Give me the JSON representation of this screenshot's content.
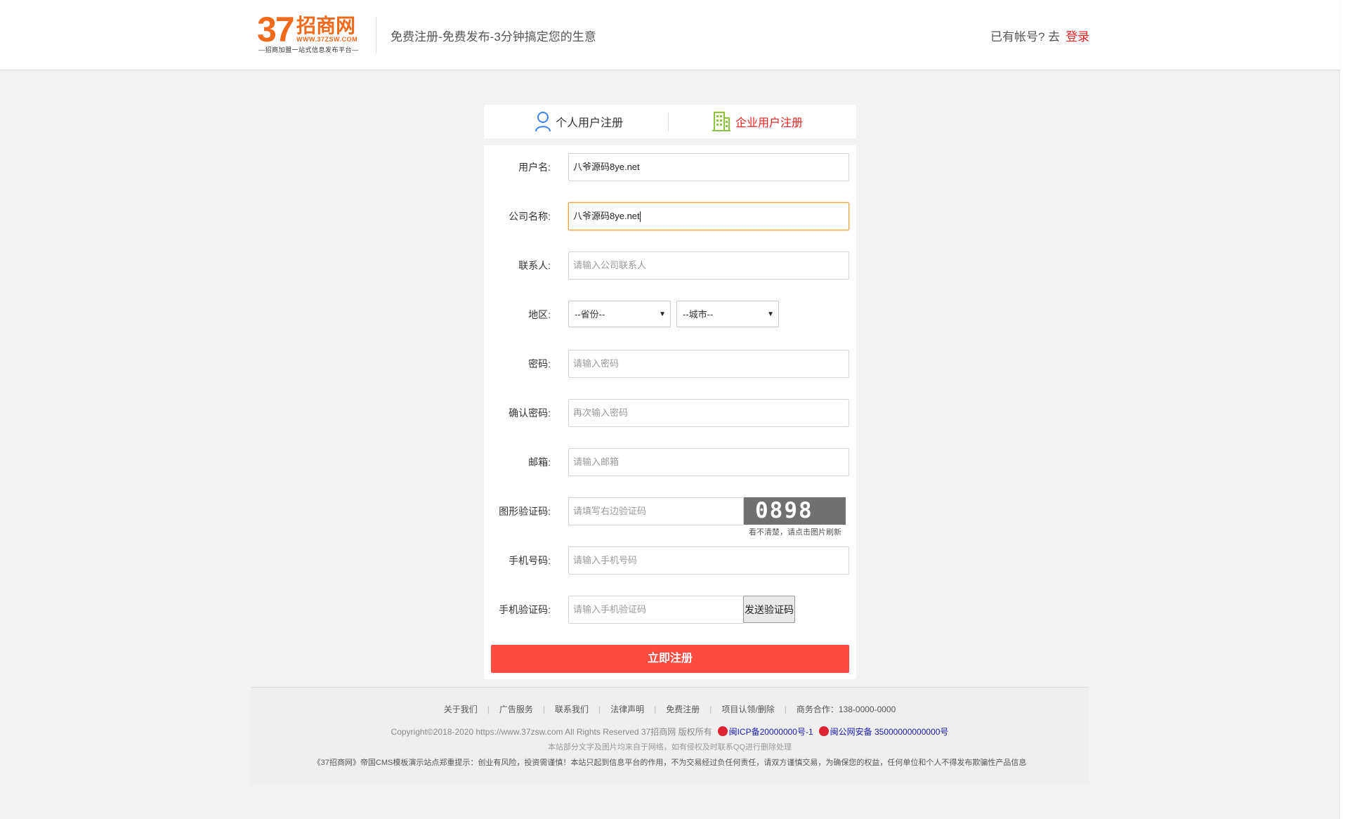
{
  "header": {
    "logo_number": "37",
    "logo_name": "招商网",
    "logo_url": "WWW.37ZSW.COM",
    "logo_slogan": "—招商加盟一站式信息发布平台—",
    "tagline": "免费注册-免费发布-3分钟搞定您的生意",
    "login_prompt": "已有帐号? 去",
    "login_link": "登录"
  },
  "tabs": {
    "personal": "个人用户注册",
    "company": "企业用户注册"
  },
  "form": {
    "username": {
      "label": "用户名:",
      "value": "八爷源码8ye.net"
    },
    "company_name": {
      "label": "公司名称:",
      "value": "八爷源码8ye.net"
    },
    "contact": {
      "label": "联系人:",
      "placeholder": "请输入公司联系人"
    },
    "region": {
      "label": "地区:",
      "province": "--省份--",
      "city": "--城市--"
    },
    "password": {
      "label": "密码:",
      "placeholder": "请输入密码"
    },
    "confirm_password": {
      "label": "确认密码:",
      "placeholder": "再次输入密码"
    },
    "email": {
      "label": "邮箱:",
      "placeholder": "请输入邮箱"
    },
    "captcha": {
      "label": "图形验证码:",
      "placeholder": "请填写右边验证码",
      "code": "0898",
      "hint": "看不清楚，请点击图片刷新"
    },
    "phone": {
      "label": "手机号码:",
      "placeholder": "请输入手机号码"
    },
    "sms_code": {
      "label": "手机验证码:",
      "placeholder": "请输入手机验证码",
      "send_button": "发送验证码"
    },
    "submit": "立即注册"
  },
  "footer": {
    "links": [
      "关于我们",
      "广告服务",
      "联系我们",
      "法律声明",
      "免费注册",
      "项目认领/删除"
    ],
    "business": "商务合作：138-0000-0000",
    "copyright": "Copyright©2018-2020 https://www.37zsw.com All Rights Reserved  37招商网 版权所有",
    "icp": "闽ICP备20000000号-1",
    "police": "闽公网安备 35000000000000号",
    "notice1": "本站部分文字及图片均来自于网络，如有侵权及时联系QQ进行删除处理",
    "notice2": "《37招商网》帝国CMS模板演示站点郑重提示：创业有风险，投资需谨慎！本站只起到信息平台的作用，不为交易经过负任何责任，请双方谨慎交易，为确保您的权益，任何单位和个人不得发布欺骗性产品信息"
  },
  "colors": {
    "accent": "#e22222",
    "brand": "#f26a1b",
    "submit": "#fd4b3f",
    "company_icon": "#8cc63f",
    "personal_icon": "#3b82f6"
  }
}
